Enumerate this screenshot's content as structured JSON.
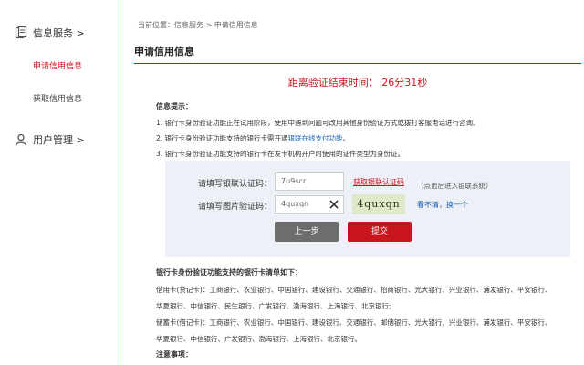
{
  "sidebar": {
    "groups": [
      {
        "label": "信息服务 >"
      },
      {
        "label": "用户管理 >"
      }
    ],
    "items": [
      {
        "label": "申请信用信息"
      },
      {
        "label": "获取信用信息"
      }
    ]
  },
  "breadcrumb": "当前位置：信息服务 > 申请信用信息",
  "page_title": "申请信用信息",
  "countdown": "距离验证结束时间： 26分31秒",
  "tips": {
    "title": "信息提示：",
    "items": [
      "1. 银行卡身份验证功能正在试用阶段，使用中遇到问题可改用其他身份验证方式或拨打客服电话进行咨询。",
      "2. 银行卡身份验证功能支持的银行卡需开通",
      "3. 银行卡身份验证功能支持的银行卡在发卡机构开户时使用的证件类型为身份证。"
    ],
    "link": "银联在线支付功能",
    "suffix": "。"
  },
  "form": {
    "unionpay_label": "请填写银联认证码：",
    "unionpay_value": "7u9scr",
    "get_code_link": "获取银联认证码",
    "get_code_hint": "（点击后进入银联系统）",
    "captcha_label": "请填写图片验证码：",
    "captcha_value": "4quxqn",
    "captcha_image_text": "4quxqn",
    "refresh_link": "看不清，换一个",
    "prev_button": "上一步",
    "submit_button": "提交"
  },
  "banks": {
    "title": "银行卡身份验证功能支持的银行卡清单如下：",
    "lines": [
      "借用卡(贷记卡)：工商银行、农业银行、中国银行、建设银行、交通银行、招商银行、光大银行、兴业银行、浦发银行、平安银行、",
      "华夏银行、中信银行、民生银行、广发银行、渤海银行、上海银行、北京银行;",
      "储蓄卡(借记卡)：工商银行、农业银行、中国银行、建设银行、交通银行、邮储银行、光大银行、兴业银行、浦发银行、平安银行、",
      "华夏银行、中信银行、广发银行、渤海银行、上海银行、北京银行。"
    ],
    "notes_title": "注意事项："
  }
}
